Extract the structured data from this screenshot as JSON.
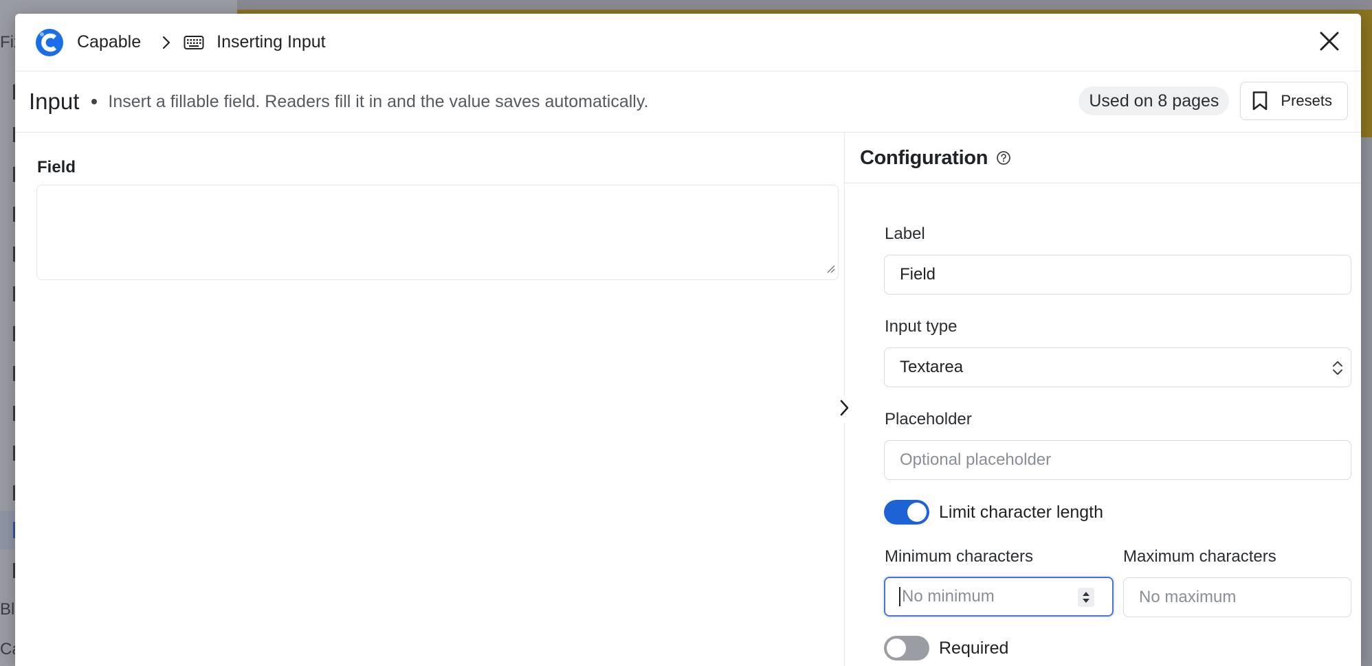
{
  "background": {
    "side_texts": [
      "Fix",
      "Bl",
      "Ca"
    ]
  },
  "breadcrumb": {
    "app_name": "Capable",
    "current": "Inserting Input"
  },
  "header": {
    "title": "Input",
    "description": "Insert a fillable field. Readers fill it in and the value saves automatically.",
    "usage_badge": "Used on 8 pages",
    "presets_label": "Presets"
  },
  "preview": {
    "field_label": "Field",
    "field_value": ""
  },
  "config": {
    "title": "Configuration",
    "label_field": {
      "label": "Label",
      "value": "Field"
    },
    "input_type": {
      "label": "Input type",
      "value": "Textarea"
    },
    "placeholder": {
      "label": "Placeholder",
      "placeholder": "Optional placeholder",
      "value": ""
    },
    "limit_length": {
      "label": "Limit character length",
      "enabled": true
    },
    "min_chars": {
      "label": "Minimum characters",
      "placeholder": "No minimum"
    },
    "max_chars": {
      "label": "Maximum characters",
      "placeholder": "No maximum"
    },
    "required": {
      "label": "Required",
      "enabled": false
    }
  },
  "colors": {
    "accent": "#1d63d6",
    "logo": "#1a6fe8",
    "background_accent": "#8a7420"
  },
  "icons": {
    "logo": "capable-logo-icon",
    "breadcrumb_separator": "chevron-right-icon",
    "breadcrumb_item": "keyboard-icon",
    "close": "close-icon",
    "presets": "bookmark-icon",
    "help": "help-circle-icon",
    "collapse": "chevron-right-icon",
    "select": "chevron-up-down-icon",
    "stepper": "stepper-arrows-icon"
  }
}
